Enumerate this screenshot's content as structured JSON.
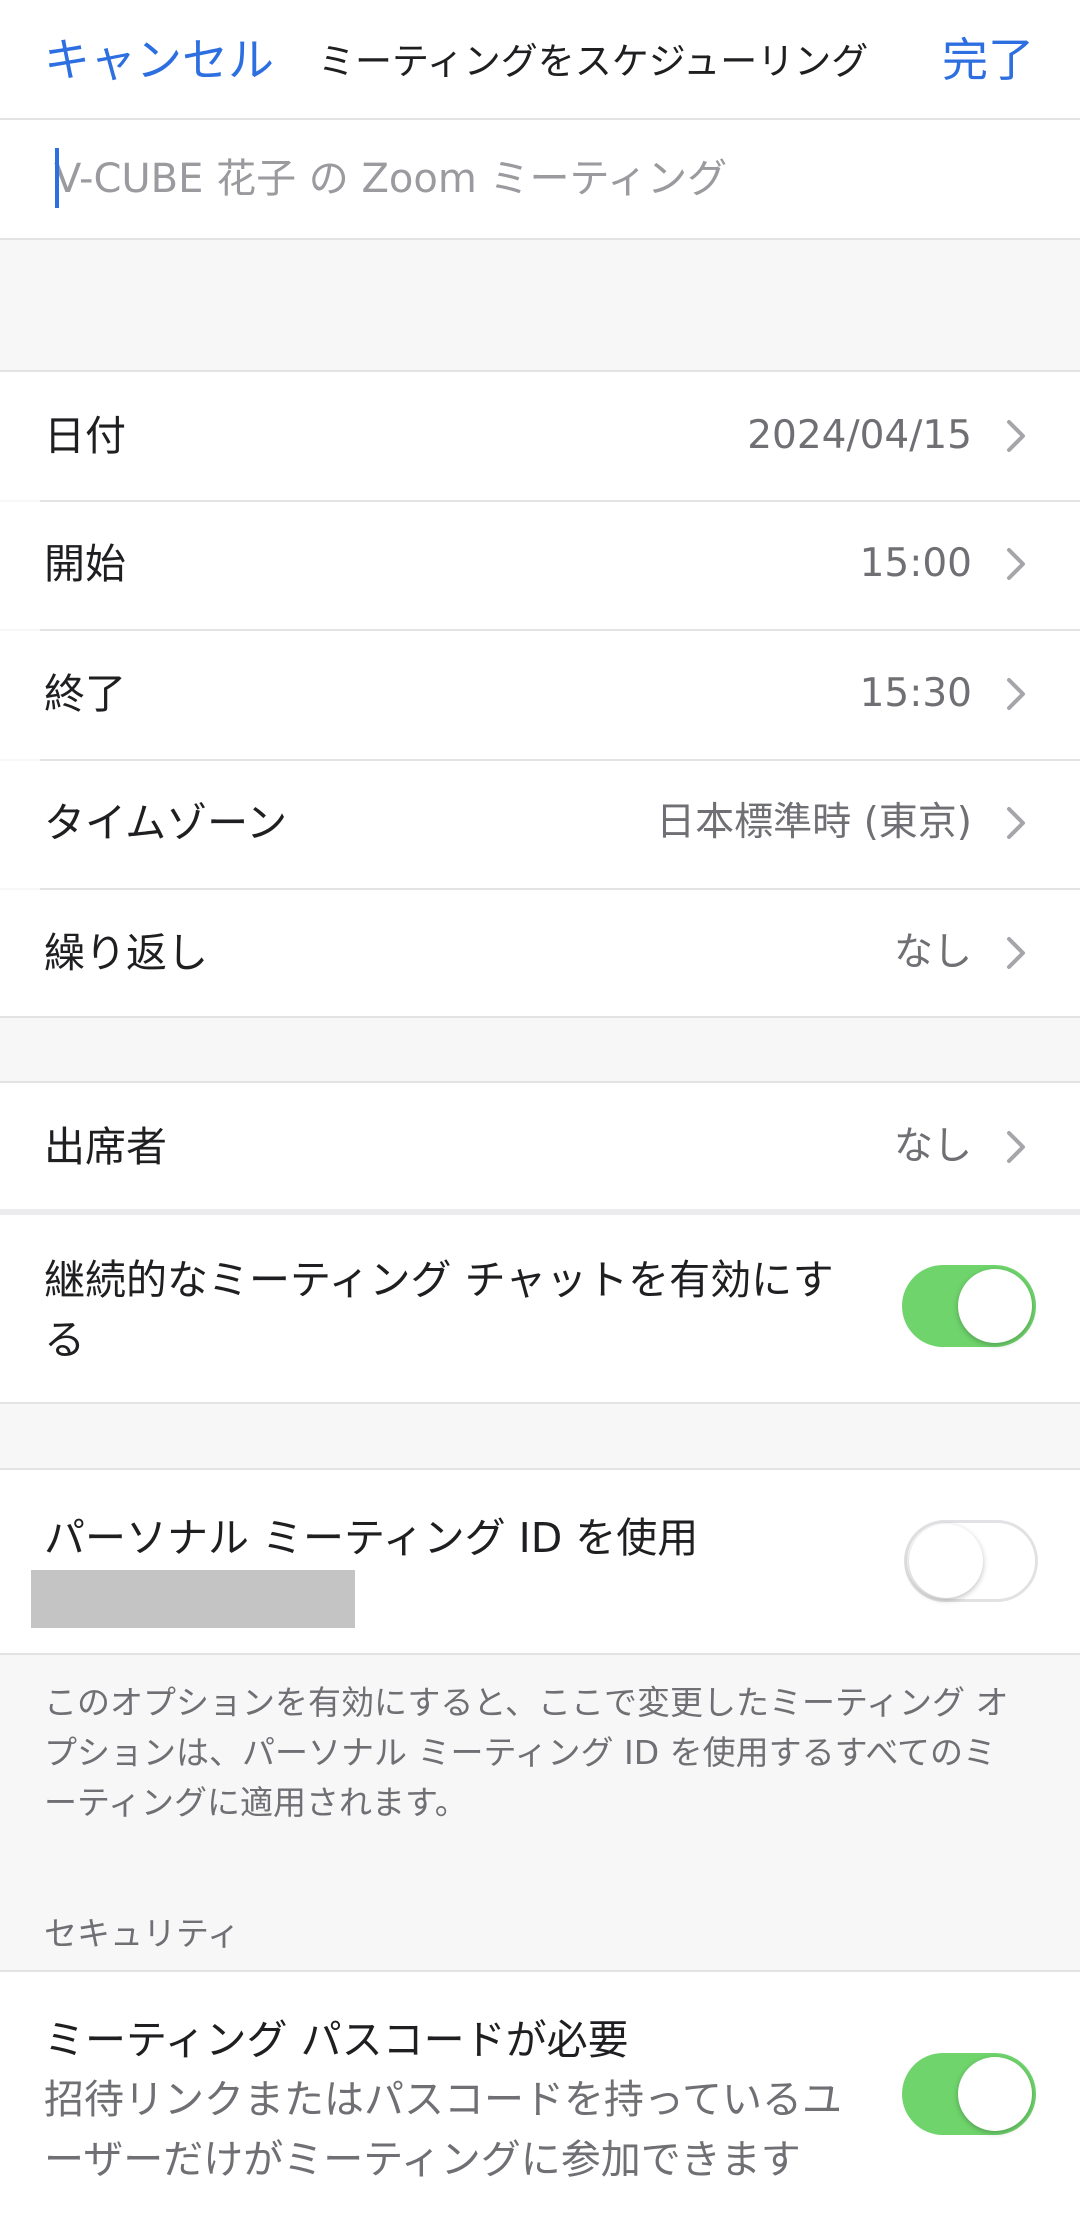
{
  "header": {
    "cancel_label": "キャンセル",
    "title": "ミーティングをスケジューリング",
    "done_label": "完了"
  },
  "topic": {
    "placeholder": "V-CUBE 花子 の Zoom ミーティング",
    "value": ""
  },
  "schedule": {
    "rows": [
      {
        "label": "日付",
        "value": "2024/04/15"
      },
      {
        "label": "開始",
        "value": "15:00"
      },
      {
        "label": "終了",
        "value": "15:30"
      },
      {
        "label": "タイムゾーン",
        "value": "日本標準時 (東京)"
      },
      {
        "label": "繰り返し",
        "value": "なし"
      }
    ]
  },
  "attendees": {
    "label": "出席者",
    "value": "なし"
  },
  "continuous_chat": {
    "label_line1": "継続的なミーティング チャットを有効にす",
    "label_line2": "る",
    "enabled": true
  },
  "personal_id": {
    "label": "パーソナル ミーティング ID を使用",
    "enabled": false,
    "info_line1": "このオプションを有効にすると、ここで変更したミーティング オ",
    "info_line2": "プションは、パーソナル ミーティング ID を使用するすべてのミ",
    "info_line3": "ーティングに適用されます。"
  },
  "security": {
    "section_title": "セキュリティ",
    "passcode_label": "ミーティング パスコードが必要",
    "passcode_desc_line1": "招待リンクまたはパスコードを持っているユ",
    "passcode_desc_line2": "ーザーだけがミーティングに参加できます",
    "passcode_enabled": true
  },
  "colors": {
    "accent": "#2d6fe0",
    "toggle_on": "#6fd46c",
    "background": "#f7f7f8"
  }
}
